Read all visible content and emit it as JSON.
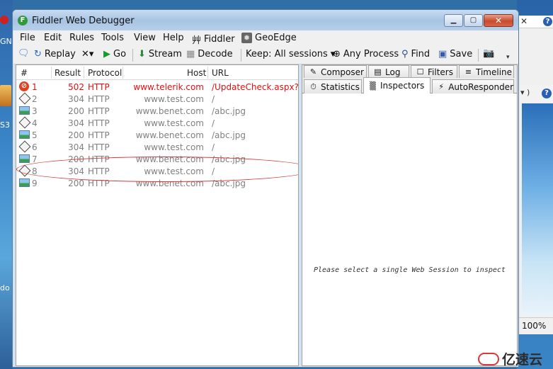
{
  "window": {
    "title": "Fiddler Web Debugger",
    "app_icon_letter": "F"
  },
  "menu": [
    "File",
    "Edit",
    "Rules",
    "Tools",
    "View",
    "Help",
    "Fiddler",
    "GeoEdge"
  ],
  "toolbar": {
    "replay": "Replay",
    "remove": "✕▾",
    "go": "Go",
    "stream": "Stream",
    "decode": "Decode",
    "keep": "Keep: All sessions",
    "any_process": "Any Process",
    "find": "Find",
    "save": "Save"
  },
  "columns": [
    "#",
    "Result",
    "Protocol",
    "Host",
    "URL"
  ],
  "sessions": [
    {
      "num": "1",
      "result": "502",
      "protocol": "HTTP",
      "host": "www.telerik.com",
      "url": "/UpdateCheck.aspx?isBet",
      "icon": "error-icon",
      "status": "error"
    },
    {
      "num": "2",
      "result": "304",
      "protocol": "HTTP",
      "host": "www.test.com",
      "url": "/",
      "icon": "diamond-icon",
      "status": "normal"
    },
    {
      "num": "3",
      "result": "200",
      "protocol": "HTTP",
      "host": "www.benet.com",
      "url": "/abc.jpg",
      "icon": "image-icon",
      "status": "normal"
    },
    {
      "num": "4",
      "result": "304",
      "protocol": "HTTP",
      "host": "www.test.com",
      "url": "/",
      "icon": "diamond-icon",
      "status": "normal"
    },
    {
      "num": "5",
      "result": "200",
      "protocol": "HTTP",
      "host": "www.benet.com",
      "url": "/abc.jpg",
      "icon": "image-icon",
      "status": "normal"
    },
    {
      "num": "6",
      "result": "304",
      "protocol": "HTTP",
      "host": "www.test.com",
      "url": "/",
      "icon": "diamond-icon",
      "status": "normal"
    },
    {
      "num": "7",
      "result": "200",
      "protocol": "HTTP",
      "host": "www.benet.com",
      "url": "/abc.jpg",
      "icon": "image-icon",
      "status": "normal"
    },
    {
      "num": "8",
      "result": "304",
      "protocol": "HTTP",
      "host": "www.test.com",
      "url": "/",
      "icon": "diamond-icon",
      "status": "normal"
    },
    {
      "num": "9",
      "result": "200",
      "protocol": "HTTP",
      "host": "www.benet.com",
      "url": "/abc.jpg",
      "icon": "image-icon",
      "status": "normal"
    }
  ],
  "tabs_row1": [
    "Composer",
    "Log",
    "Filters",
    "Timeline"
  ],
  "tabs_row2": [
    "Statistics",
    "Inspectors",
    "AutoResponder"
  ],
  "active_tab": "Inspectors",
  "inspector_empty_message": "Please select a single Web Session to inspect",
  "background_window": {
    "zoom": "100%",
    "left_labels": [
      "GN",
      "S3",
      "do"
    ]
  },
  "watermark": "亿速云",
  "colors": {
    "error_text": "#e01010",
    "dim_text": "#808080",
    "annotation": "#d63a3a"
  }
}
